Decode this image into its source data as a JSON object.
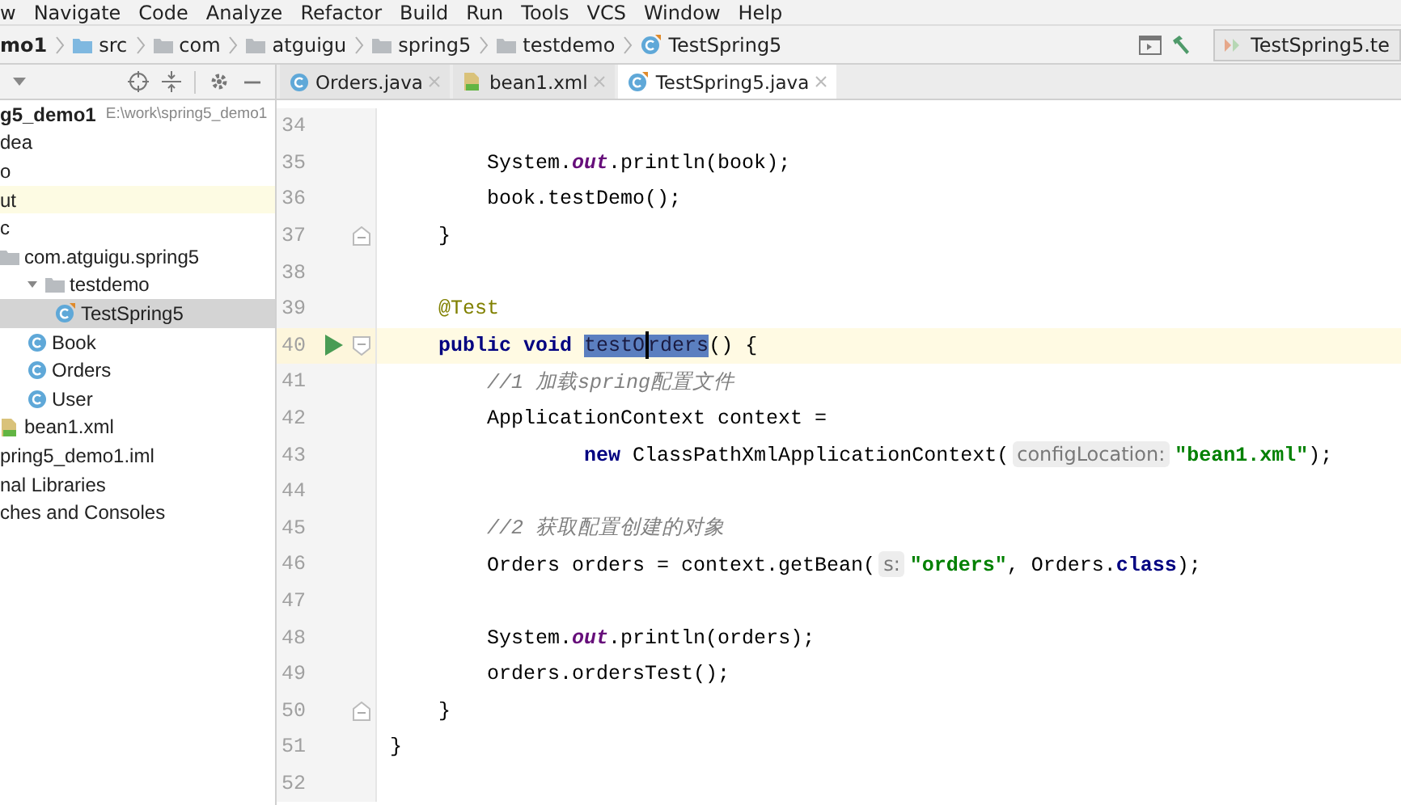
{
  "menu": [
    "w",
    "Navigate",
    "Code",
    "Analyze",
    "Refactor",
    "Build",
    "Run",
    "Tools",
    "VCS",
    "Window",
    "Help"
  ],
  "breadcrumbs": [
    {
      "text": "mo1",
      "kind": "project"
    },
    {
      "text": "src",
      "kind": "source_folder"
    },
    {
      "text": "com",
      "kind": "folder"
    },
    {
      "text": "atguigu",
      "kind": "folder"
    },
    {
      "text": "spring5",
      "kind": "folder"
    },
    {
      "text": "testdemo",
      "kind": "folder"
    },
    {
      "text": "TestSpring5",
      "kind": "test_class"
    }
  ],
  "run_config": "TestSpring5.te",
  "tabs": [
    {
      "label": "Orders.java",
      "kind": "class",
      "selected": false
    },
    {
      "label": "bean1.xml",
      "kind": "xml",
      "selected": false
    },
    {
      "label": "TestSpring5.java",
      "kind": "test_class",
      "selected": true
    }
  ],
  "project_tree": [
    {
      "label": "g5_demo1",
      "path": "E:\\work\\spring5_demo1",
      "selected": false,
      "highlighted": false,
      "children": [
        {
          "label": "dea",
          "selected": false,
          "highlighted": false
        },
        {
          "label": "o",
          "selected": false,
          "highlighted": false
        },
        {
          "label": "ut",
          "selected": false,
          "highlighted": true
        },
        {
          "label": "c",
          "selected": false,
          "highlighted": false,
          "children": [
            {
              "label": "com.atguigu.spring5",
              "kind": "package",
              "selected": false,
              "highlighted": false,
              "children": [
                {
                  "label": "testdemo",
                  "kind": "package",
                  "expanded": true,
                  "selected": false,
                  "highlighted": false,
                  "children": [
                    {
                      "label": "TestSpring5",
                      "kind": "test_class",
                      "selected": true,
                      "highlighted": false
                    }
                  ]
                },
                {
                  "label": "Book",
                  "kind": "class",
                  "selected": false,
                  "highlighted": false
                },
                {
                  "label": "Orders",
                  "kind": "class",
                  "selected": false,
                  "highlighted": false
                },
                {
                  "label": "User",
                  "kind": "class",
                  "selected": false,
                  "highlighted": false
                }
              ]
            },
            {
              "label": "bean1.xml",
              "kind": "xml",
              "selected": false,
              "highlighted": false
            }
          ]
        },
        {
          "label": "pring5_demo1.iml",
          "selected": false,
          "highlighted": false
        }
      ]
    },
    {
      "label": "nal Libraries",
      "selected": false,
      "highlighted": false
    },
    {
      "label": "ches and Consoles",
      "selected": false,
      "highlighted": false
    }
  ],
  "editor_lines": [
    {
      "number": "34",
      "kind": "plain",
      "current": false,
      "run": false
    },
    {
      "number": "35",
      "kind": "plain",
      "current": false,
      "run": false,
      "tokens": [
        {
          "kind": "plain",
          "text": "        System."
        },
        {
          "kind": "field",
          "text": "out"
        },
        {
          "kind": "plain",
          "text": ".println(book);"
        }
      ]
    },
    {
      "number": "36",
      "kind": "plain",
      "current": false,
      "run": false,
      "tokens": [
        {
          "kind": "plain",
          "text": "        book.testDemo();"
        }
      ]
    },
    {
      "number": "37",
      "kind": "fold_end",
      "current": false,
      "run": false,
      "tokens": [
        {
          "kind": "plain",
          "text": "    }"
        }
      ]
    },
    {
      "number": "38",
      "kind": "plain",
      "current": false,
      "run": false
    },
    {
      "number": "39",
      "kind": "plain",
      "current": false,
      "run": false,
      "tokens": [
        {
          "kind": "annotation",
          "text": "    @Test"
        }
      ]
    },
    {
      "number": "40",
      "kind": "fold_start",
      "current": true,
      "run": true,
      "tokens": [
        {
          "kind": "keyword",
          "text": "    public void "
        },
        {
          "kind": "selected",
          "text": "testO"
        },
        {
          "kind": "caret"
        },
        {
          "kind": "selected",
          "text": "rders"
        },
        {
          "kind": "plain",
          "text": "() {"
        }
      ]
    },
    {
      "number": "41",
      "kind": "plain",
      "current": false,
      "run": false,
      "tokens": [
        {
          "kind": "comment",
          "text": "        //1 加载spring配置文件"
        }
      ]
    },
    {
      "number": "42",
      "kind": "plain",
      "current": false,
      "run": false,
      "tokens": [
        {
          "kind": "plain",
          "text": "        ApplicationContext context ="
        }
      ]
    },
    {
      "number": "43",
      "kind": "plain",
      "current": false,
      "run": false,
      "tokens": [
        {
          "kind": "keyword",
          "text": "                new "
        },
        {
          "kind": "plain",
          "text": "ClassPathXmlApplicationContext("
        },
        {
          "kind": "hint",
          "text": "configLocation:"
        },
        {
          "kind": "string",
          "text": "\"bean1.xml\""
        },
        {
          "kind": "plain",
          "text": ");"
        }
      ]
    },
    {
      "number": "44",
      "kind": "plain",
      "current": false,
      "run": false
    },
    {
      "number": "45",
      "kind": "plain",
      "current": false,
      "run": false,
      "tokens": [
        {
          "kind": "comment",
          "text": "        //2 获取配置创建的对象"
        }
      ]
    },
    {
      "number": "46",
      "kind": "plain",
      "current": false,
      "run": false,
      "tokens": [
        {
          "kind": "plain",
          "text": "        Orders orders = context.getBean("
        },
        {
          "kind": "hint",
          "text": "s:"
        },
        {
          "kind": "string",
          "text": "\"orders\""
        },
        {
          "kind": "plain",
          "text": ", Orders."
        },
        {
          "kind": "keyword",
          "text": "class"
        },
        {
          "kind": "plain",
          "text": ");"
        }
      ]
    },
    {
      "number": "47",
      "kind": "plain",
      "current": false,
      "run": false
    },
    {
      "number": "48",
      "kind": "plain",
      "current": false,
      "run": false,
      "tokens": [
        {
          "kind": "plain",
          "text": "        System."
        },
        {
          "kind": "field",
          "text": "out"
        },
        {
          "kind": "plain",
          "text": ".println(orders);"
        }
      ]
    },
    {
      "number": "49",
      "kind": "plain",
      "current": false,
      "run": false,
      "tokens": [
        {
          "kind": "plain",
          "text": "        orders.ordersTest();"
        }
      ]
    },
    {
      "number": "50",
      "kind": "fold_end",
      "current": false,
      "run": false,
      "tokens": [
        {
          "kind": "plain",
          "text": "    }"
        }
      ]
    },
    {
      "number": "51",
      "kind": "plain",
      "current": false,
      "run": false,
      "tokens": [
        {
          "kind": "plain",
          "text": "}"
        }
      ]
    },
    {
      "number": "52",
      "kind": "plain",
      "current": false,
      "run": false
    }
  ]
}
